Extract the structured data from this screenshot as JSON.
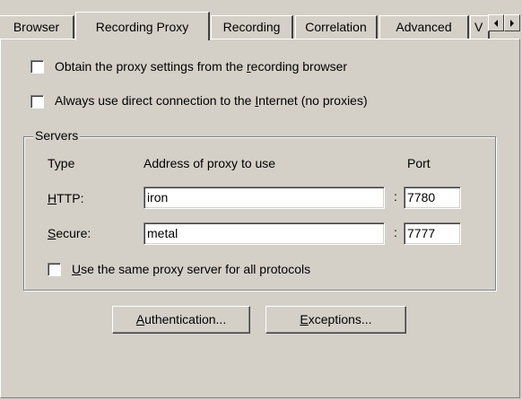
{
  "tabs": [
    {
      "label": "Browser",
      "active": false
    },
    {
      "label": "Recording Proxy",
      "active": true
    },
    {
      "label": "Recording",
      "active": false
    },
    {
      "label": "Correlation",
      "active": false
    },
    {
      "label": "Advanced",
      "active": false
    },
    {
      "label": "V",
      "active": false
    }
  ],
  "options": {
    "obtain_proxy": {
      "pre": "Obtain the proxy settings from the ",
      "mnemonic": "r",
      "post": "ecording browser",
      "checked": false
    },
    "direct_connection": {
      "pre": "Always use direct connection to the ",
      "mnemonic": "I",
      "post": "nternet (no proxies)",
      "checked": false
    }
  },
  "servers": {
    "title": "Servers",
    "headers": {
      "type": "Type",
      "address": "Address of proxy to use",
      "port": "Port"
    },
    "http": {
      "mnemonic": "H",
      "rest": "TTP:",
      "address": "iron",
      "separator": ":",
      "port": "7780"
    },
    "secure": {
      "mnemonic": "S",
      "rest": "ecure:",
      "address": "metal",
      "separator": ":",
      "port": "7777"
    },
    "same_proxy": {
      "mnemonic": "U",
      "post": "se the same proxy server for all protocols",
      "checked": false
    }
  },
  "buttons": {
    "authentication": {
      "mnemonic": "A",
      "rest": "uthentication..."
    },
    "exceptions": {
      "mnemonic": "E",
      "rest": "xceptions..."
    }
  },
  "colors": {
    "face": "#d4d0c8",
    "shadow": "#808080",
    "dark_shadow": "#404040",
    "highlight": "#ffffff"
  }
}
